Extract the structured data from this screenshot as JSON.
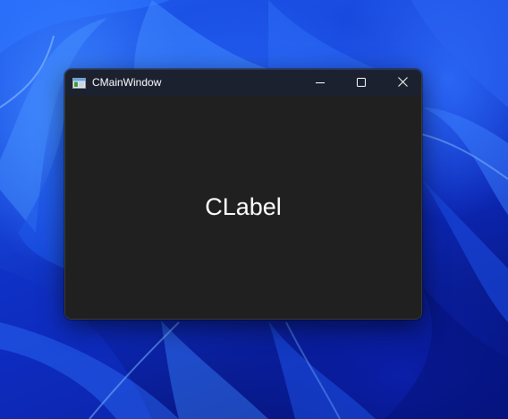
{
  "window": {
    "title": "CMainWindow",
    "app_icon": "app-window-icon",
    "controls": {
      "minimize_icon": "minimize-icon",
      "maximize_icon": "maximize-icon",
      "close_icon": "close-icon"
    }
  },
  "content": {
    "label": "CLabel"
  },
  "colors": {
    "window_background": "#202020",
    "titlebar_background": "#1c2130",
    "text": "#ffffff",
    "wallpaper_accent": "#1f5cf0"
  }
}
